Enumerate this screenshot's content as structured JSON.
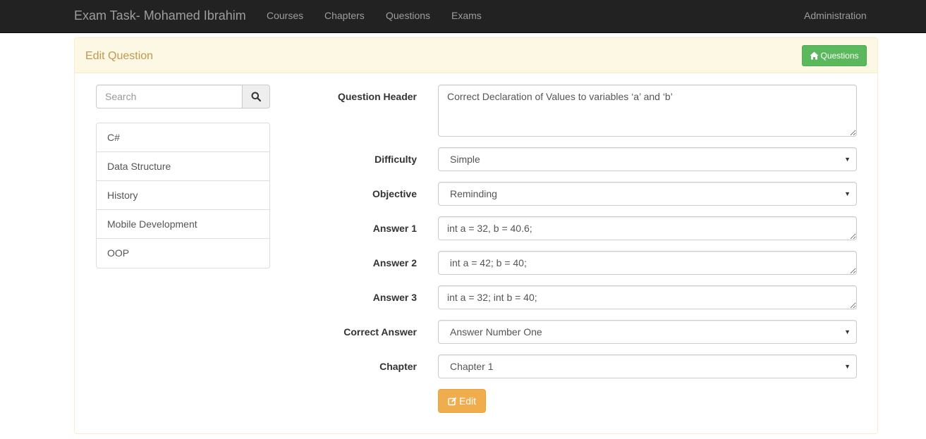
{
  "navbar": {
    "brand": "Exam Task- Mohamed Ibrahim",
    "links": [
      "Courses",
      "Chapters",
      "Questions",
      "Exams"
    ],
    "right_link": "Administration"
  },
  "panel": {
    "title": "Edit Question",
    "questions_button": "Questions"
  },
  "search": {
    "placeholder": "Search",
    "value": ""
  },
  "courses": [
    "C#",
    "Data Structure",
    "History",
    "Mobile Development",
    "OOP"
  ],
  "form": {
    "question_header": {
      "label": "Question Header",
      "value": "Correct Declaration of Values to variables ‘a’ and ‘b’"
    },
    "difficulty": {
      "label": "Difficulty",
      "selected": "Simple"
    },
    "objective": {
      "label": "Objective",
      "selected": "Reminding"
    },
    "answer1": {
      "label": "Answer 1",
      "value": "int a = 32, b = 40.6;"
    },
    "answer2": {
      "label": "Answer 2",
      "value": " int a = 42; b = 40;"
    },
    "answer3": {
      "label": "Answer 3",
      "value": "int a = 32; int b = 40;"
    },
    "correct_answer": {
      "label": "Correct Answer",
      "selected": "Answer Number One"
    },
    "chapter": {
      "label": "Chapter",
      "selected": "Chapter 1"
    },
    "edit_button": "Edit"
  },
  "colors": {
    "navbar_bg": "#222222",
    "panel_heading_bg": "#fcf8e3",
    "panel_title": "#c09853",
    "success": "#5cb85c",
    "warning": "#f0ad4e"
  },
  "icons": {
    "questions_button": "home-icon",
    "search_button": "search-icon",
    "edit_button": "edit-icon",
    "select_caret": "caret-down-icon"
  }
}
